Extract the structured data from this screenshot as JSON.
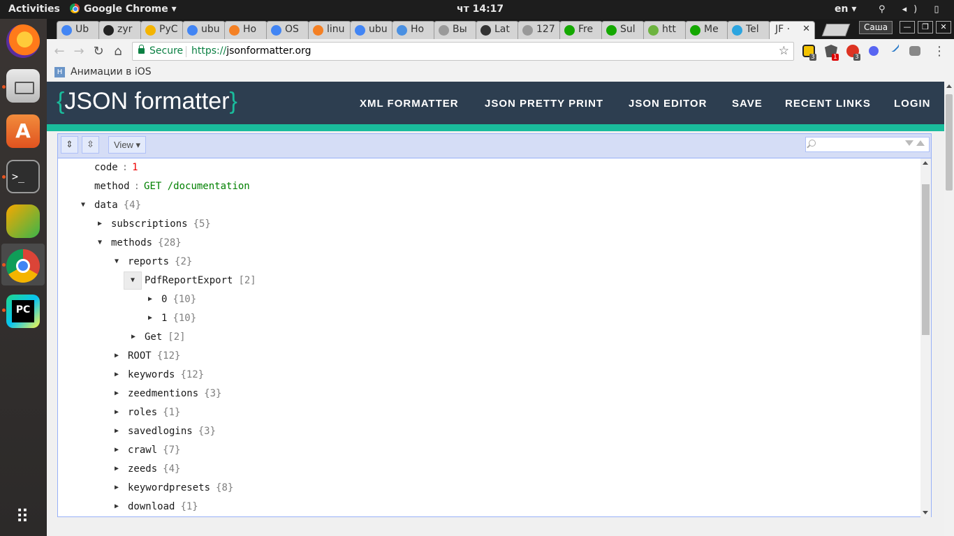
{
  "topbar": {
    "activities": "Activities",
    "app_menu": "Google Chrome ▾",
    "clock": "чт 14:17",
    "lang": "en ▾",
    "system_icons": "⚲ ◂) ▯ ▾"
  },
  "chrome": {
    "tabs": [
      {
        "label": "Ub",
        "fav_color": "#4285f4"
      },
      {
        "label": "zyr",
        "fav_color": "#222222"
      },
      {
        "label": "PyC",
        "fav_color": "#f4b400"
      },
      {
        "label": "ubu",
        "fav_color": "#4285f4"
      },
      {
        "label": "Ho",
        "fav_color": "#f48024"
      },
      {
        "label": "OS",
        "fav_color": "#4285f4"
      },
      {
        "label": "linu",
        "fav_color": "#f48024"
      },
      {
        "label": "ubu",
        "fav_color": "#4285f4"
      },
      {
        "label": "Ho",
        "fav_color": "#4a90e2"
      },
      {
        "label": "Вы",
        "fav_color": "#999999"
      },
      {
        "label": "Lat",
        "fav_color": "#333333"
      },
      {
        "label": "127",
        "fav_color": "#999999"
      },
      {
        "label": "Fre",
        "fav_color": "#14a800"
      },
      {
        "label": "Sul",
        "fav_color": "#14a800"
      },
      {
        "label": "htt",
        "fav_color": "#6db33f"
      },
      {
        "label": "Me",
        "fav_color": "#14a800"
      },
      {
        "label": "Tel",
        "fav_color": "#2ca5e0"
      },
      {
        "label": "JF ·",
        "fav_color": "#f2f2f2",
        "close": "✕"
      }
    ],
    "profile": "Саша",
    "window_buttons": [
      "—",
      "❐",
      "✕"
    ],
    "secure_label": "Secure",
    "url_scheme": "https://",
    "url_host": "jsonformatter.org",
    "star": "☆",
    "ext_badges": [
      "3",
      "1",
      "3"
    ],
    "menu": "⋮",
    "bookmark_label": "Анимации в iOS",
    "bookmark_fav": "H"
  },
  "site": {
    "logo_brace_open": "{",
    "logo_text": "JSON formatter",
    "logo_brace_close": "}",
    "nav": [
      "XML FORMATTER",
      "JSON PRETTY PRINT",
      "JSON EDITOR",
      "SAVE",
      "RECENT LINKS",
      "LOGIN"
    ]
  },
  "editor": {
    "expand_all": "⇕",
    "collapse_all": "⇳",
    "view_label": "View ▾",
    "search_placeholder": "",
    "rows": [
      {
        "key": "code",
        "value": "1",
        "value_type": "num",
        "caret": ""
      },
      {
        "key": "method",
        "value": "GET /documentation",
        "value_type": "str",
        "caret": ""
      },
      {
        "key": "data",
        "count": "{4}",
        "caret": "▼"
      },
      {
        "key": "subscriptions",
        "count": "{5}",
        "caret": "▶"
      },
      {
        "key": "methods",
        "count": "{28}",
        "caret": "▼"
      },
      {
        "key": "reports",
        "count": "{2}",
        "caret": "▼"
      },
      {
        "key": "PdfReportExport",
        "count": "[2]",
        "caret": "▼"
      },
      {
        "key": "0",
        "count": "{10}",
        "caret": "▶"
      },
      {
        "key": "1",
        "count": "{10}",
        "caret": "▶"
      },
      {
        "key": "Get",
        "count": "[2]",
        "caret": "▶"
      },
      {
        "key": "ROOT",
        "count": "{12}",
        "caret": "▶"
      },
      {
        "key": "keywords",
        "count": "{12}",
        "caret": "▶"
      },
      {
        "key": "zeedmentions",
        "count": "{3}",
        "caret": "▶"
      },
      {
        "key": "roles",
        "count": "{1}",
        "caret": "▶"
      },
      {
        "key": "savedlogins",
        "count": "{3}",
        "caret": "▶"
      },
      {
        "key": "crawl",
        "count": "{7}",
        "caret": "▶"
      },
      {
        "key": "zeeds",
        "count": "{4}",
        "caret": "▶"
      },
      {
        "key": "keywordpresets",
        "count": "{8}",
        "caret": "▶"
      },
      {
        "key": "download",
        "count": "{1}",
        "caret": "▶"
      }
    ]
  },
  "dock": {
    "store_glyph": "A",
    "terminal_glyph": ">_",
    "apps_glyph": "⠿"
  },
  "colors": {
    "header_bg": "#2d3e50",
    "accent": "#1abc9c",
    "secure_green": "#0b8043"
  }
}
